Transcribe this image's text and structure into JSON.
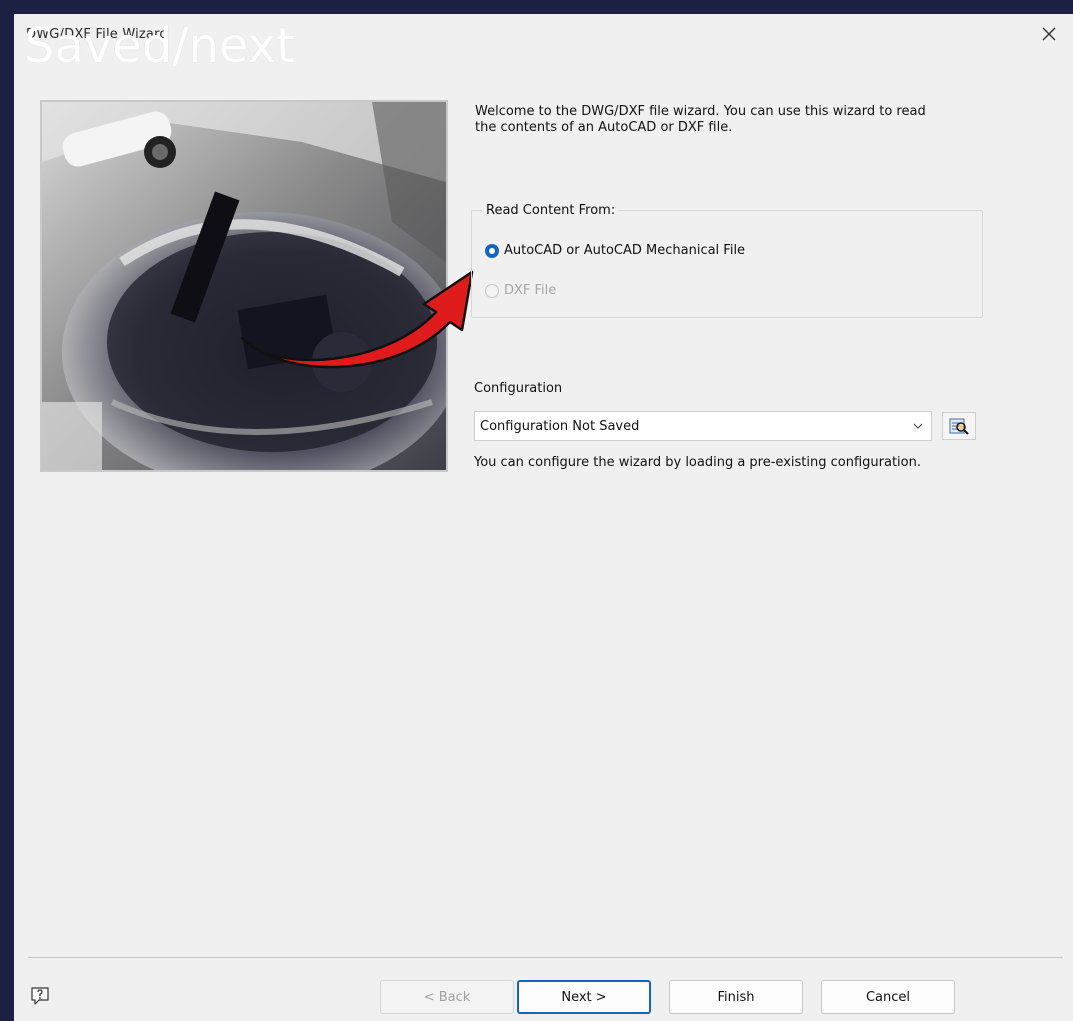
{
  "window": {
    "title": "DWG/DXF File Wizard",
    "overlay_caption": "Saved/next"
  },
  "welcome": {
    "line1": "Welcome to the DWG/DXF file wizard. You can use this wizard to read",
    "line2": "the contents of an AutoCAD or DXF file."
  },
  "read_content": {
    "title": "Read Content From:",
    "options": [
      {
        "label": "AutoCAD or AutoCAD Mechanical File",
        "checked": true,
        "enabled": true
      },
      {
        "label": "DXF File",
        "checked": false,
        "enabled": false
      }
    ]
  },
  "configuration": {
    "label": "Configuration",
    "selected": "Configuration Not Saved",
    "hint": "You can configure the wizard by loading a pre-existing configuration."
  },
  "footer": {
    "back_label": "< Back",
    "next_label": "Next >",
    "finish_label": "Finish",
    "cancel_label": "Cancel"
  },
  "colors": {
    "accent": "#1464c8",
    "annotation_arrow": "#e01b1b",
    "dialog_bg": "#f0f0f0",
    "desktop_bg": "#1e2140"
  },
  "icons": {
    "close": "close-icon",
    "help": "help-icon",
    "browse": "browse-config-icon",
    "dropdown": "chevron-down-icon"
  }
}
